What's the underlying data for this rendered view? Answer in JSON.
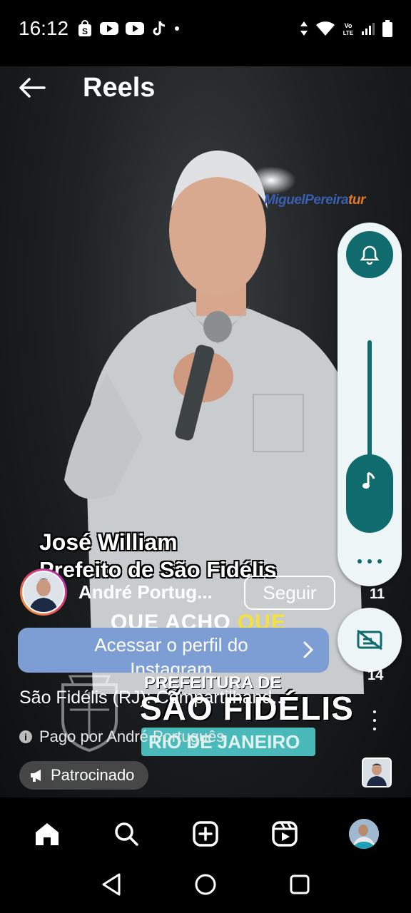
{
  "status_bar": {
    "time": "16:12",
    "left_icons": [
      "shopee-icon",
      "youtube-icon",
      "youtube-icon",
      "tiktok-icon",
      "dot-icon"
    ],
    "right_icons": [
      "data-arrows-icon",
      "wifi-icon",
      "volte-icon",
      "signal-icon",
      "battery-icon"
    ]
  },
  "header": {
    "title": "Reels"
  },
  "video": {
    "logo_part1": "MiguelPereira",
    "logo_part2": "tur",
    "caption_name": "José William",
    "caption_title": "Prefeito de São Fidélis",
    "caption_quote_white": "QUE ACHO ",
    "caption_quote_yellow": "QUE",
    "brand_top": "PREFEITURA DE",
    "brand_main": "SÃO FIDÉLIS",
    "brand_sub": "RIO DE JANEIRO"
  },
  "post": {
    "username": "André Portug...",
    "follow_label": "Seguir",
    "cta_label": "Acessar o perfil do Instagram",
    "description": "São Fidélis (RJ): Compartilhand...",
    "paid_by": "Pago por André Português",
    "sponsored_label": "Patrocinado",
    "like_count": "11",
    "comment_count": "14"
  },
  "overlay": {
    "bell_icon": "bell-icon",
    "music_icon": "music-note-icon",
    "more_icon": "more-horizontal-icon",
    "captions_off_icon": "captions-off-icon"
  },
  "colors": {
    "overlay_teal": "#0f6b6e",
    "overlay_bg": "#eef5f6",
    "cta_blue": "#7c9ed4",
    "quote_yellow": "#f4e23a",
    "brand_teal": "#49b9b9"
  },
  "bottom_nav": [
    "home-icon",
    "search-icon",
    "create-icon",
    "reels-icon",
    "profile-avatar"
  ],
  "system_nav": [
    "back-icon",
    "home-circle-icon",
    "recents-icon"
  ]
}
